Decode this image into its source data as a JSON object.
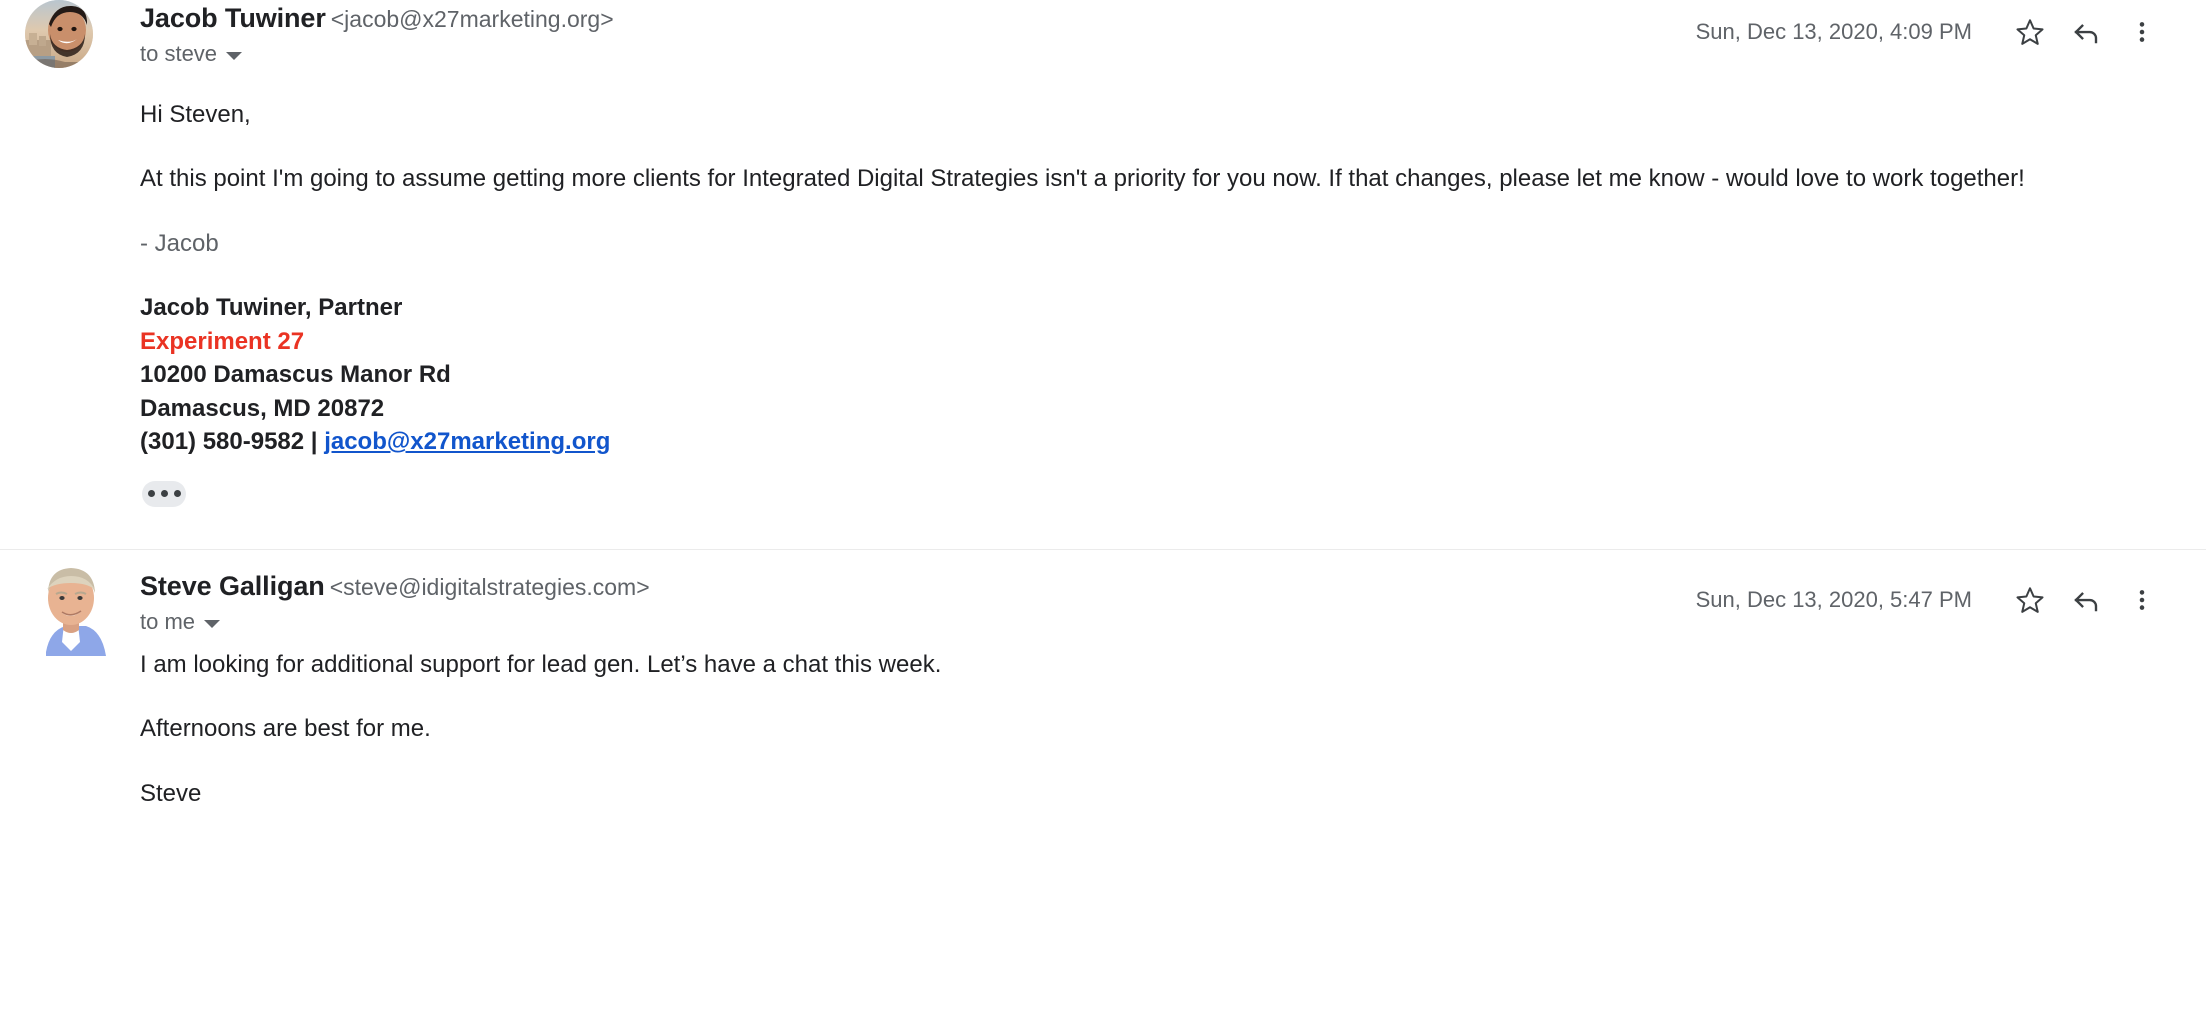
{
  "thread": {
    "messages": [
      {
        "id": "msg-1",
        "sender_name": "Jacob Tuwiner",
        "sender_email": "<jacob@x27marketing.org>",
        "recipient": "to steve",
        "timestamp": "Sun, Dec 13, 2020, 4:09 PM",
        "avatar_alt": "Jacob Tuwiner profile photo",
        "body": {
          "greeting": "Hi Steven,",
          "paragraph": "At this point I'm going to assume getting more clients for Integrated Digital Strategies isn't a priority for you now. If that changes, please let me know - would love to work together!",
          "sign_off": "- Jacob"
        },
        "signature": {
          "name_title": "Jacob Tuwiner, Partner",
          "company": "Experiment 27",
          "address_line1": "10200 Damascus Manor Rd",
          "address_line2": "Damascus, MD 20872",
          "phone": "(301) 580-9582",
          "separator": " | ",
          "email_link": "jacob@x27marketing.org"
        },
        "trimmed_content_label": "Show trimmed content"
      },
      {
        "id": "msg-2",
        "sender_name": "Steve Galligan",
        "sender_email": "<steve@idigitalstrategies.com>",
        "recipient": "to me",
        "timestamp": "Sun, Dec 13, 2020, 5:47 PM",
        "avatar_alt": "Steve Galligan profile photo",
        "body": {
          "paragraph1": "I am looking for additional support for lead gen. Let’s have a chat this week.",
          "paragraph2": "Afternoons are best for me.",
          "sign_off": "Steve"
        }
      }
    ],
    "icons": {
      "star": "star-icon",
      "reply": "reply-icon",
      "more": "more-options-icon",
      "caret": "chevron-down-icon",
      "trimmed": "ellipsis-icon"
    },
    "colors": {
      "brand_red": "#ea3323",
      "link_blue": "#1155cc",
      "text_primary": "#202124",
      "text_secondary": "#5f6368",
      "divider": "#ebebeb",
      "chip_bg": "#e8eaed"
    }
  }
}
